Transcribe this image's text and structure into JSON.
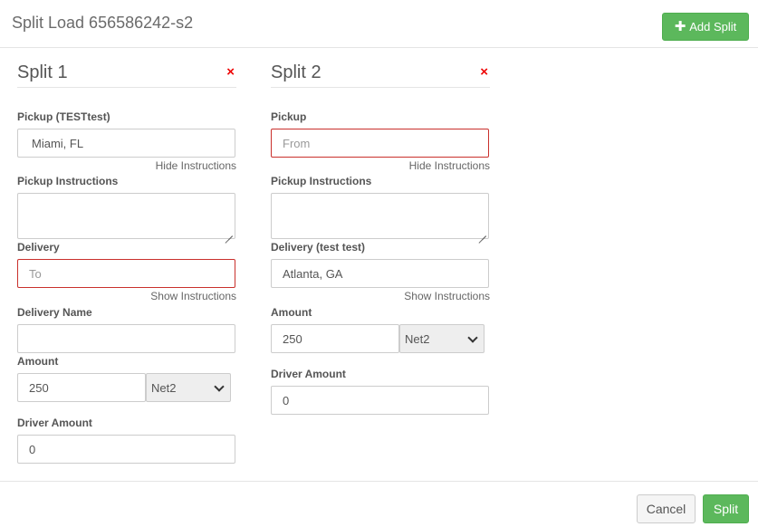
{
  "modal": {
    "title": "Split Load 656586242-s2",
    "add_split_label": "Add Split",
    "add_split_icon": "plus-icon",
    "remove_icon": "remove-x-icon",
    "accent_color": "#5cb85c",
    "error_color": "#c9302c",
    "remove_color": "#ee0000"
  },
  "split1": {
    "title": "Split 1",
    "remove_symbol": "×",
    "pickup_label": "Pickup (TESTtest)",
    "pickup_value": "Miami, FL",
    "pickup_hint": "Hide Instructions",
    "pickup_instructions_label": "Pickup Instructions",
    "pickup_instructions_value": "",
    "delivery_label": "Delivery",
    "delivery_placeholder": "To",
    "delivery_hint": "Show Instructions",
    "delivery_name_label": "Delivery Name",
    "delivery_name_value": "",
    "amount_label": "Amount",
    "amount_value": "250",
    "terms_value": "Net2",
    "driver_amount_label": "Driver Amount",
    "driver_amount_value": "0"
  },
  "split2": {
    "title": "Split 2",
    "remove_symbol": "×",
    "pickup_label": "Pickup",
    "pickup_placeholder": "From",
    "pickup_hint": "Hide Instructions",
    "pickup_instructions_label": "Pickup Instructions",
    "pickup_instructions_value": "",
    "delivery_label": "Delivery (test test)",
    "delivery_value": "Atlanta, GA",
    "delivery_hint": "Show Instructions",
    "amount_label": "Amount",
    "amount_value": "250",
    "terms_value": "Net2",
    "driver_amount_label": "Driver Amount",
    "driver_amount_value": "0"
  },
  "footer": {
    "cancel_label": "Cancel",
    "split_label": "Split"
  }
}
